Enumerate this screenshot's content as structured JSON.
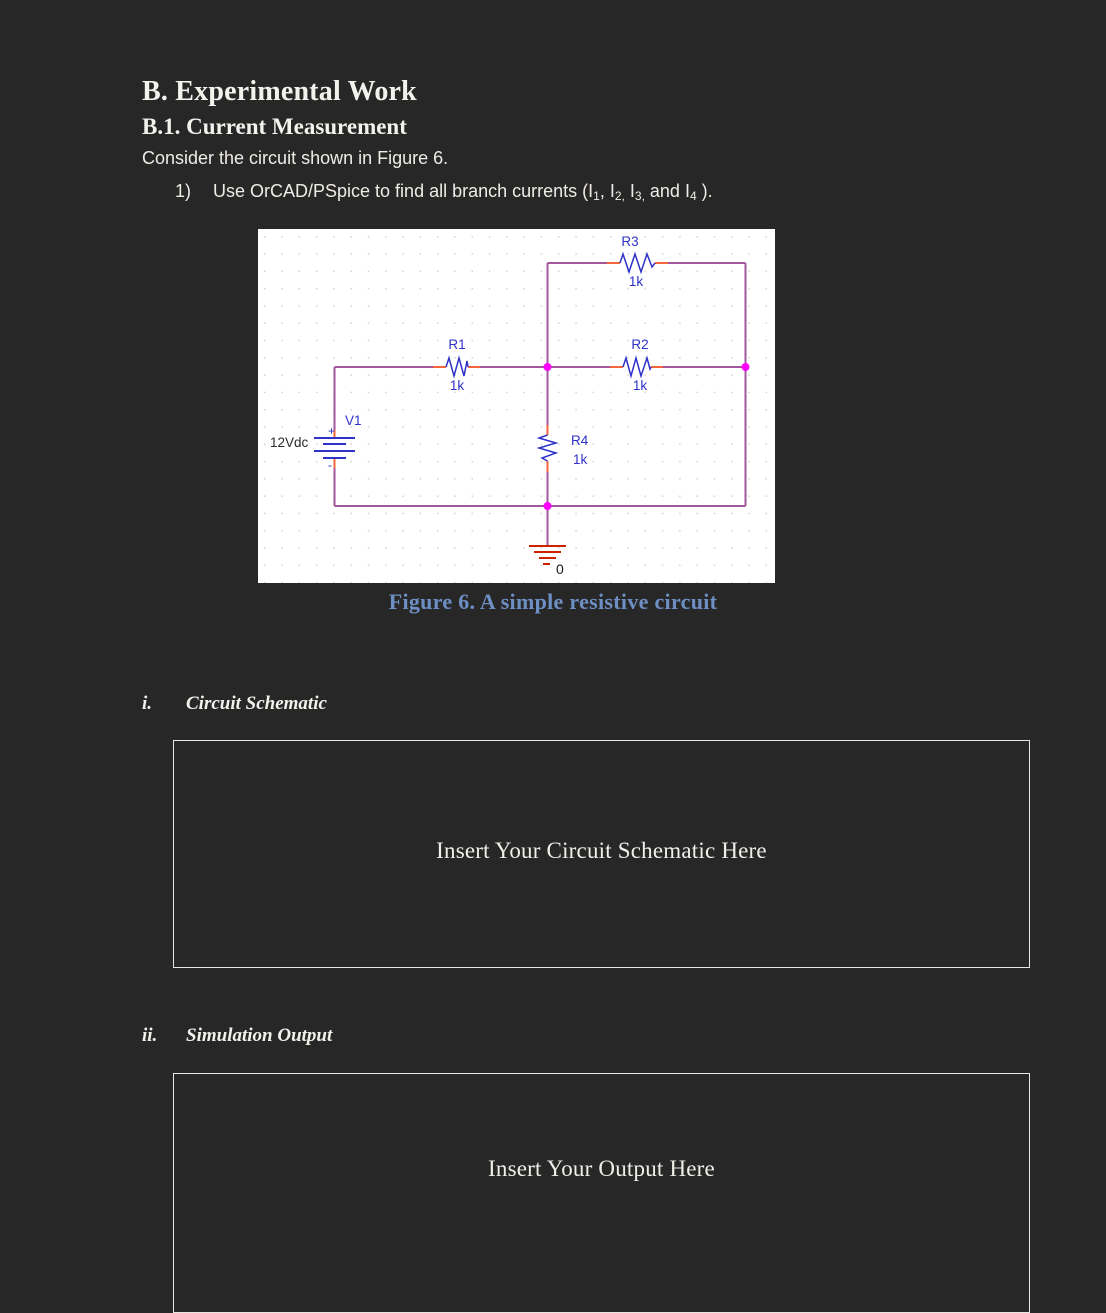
{
  "document": {
    "section_title": "B. Experimental Work",
    "subsection_title": "B.1. Current Measurement",
    "intro_line": "Consider the circuit shown in Figure 6.",
    "task": {
      "number": "1)",
      "text_before": "Use OrCAD/PSpice to find all branch currents (I",
      "sub1": "1",
      "mid1": ", I",
      "sub2": "2,",
      "mid2": " I",
      "sub3": "3,",
      "mid3": " and I",
      "sub4": "4",
      "text_after": " )."
    },
    "figure": {
      "caption": "Figure 6. A simple resistive circuit",
      "caption_color": "#6d8fc4",
      "background": "#ffffff",
      "wire_color": "#a1579c",
      "lead_color": "#f4663b",
      "resistor_color": "#2f31c8",
      "label_color": "#2f31c8",
      "junction_color": "#ff00ff",
      "ground_color": "#cc2200",
      "components": [
        {
          "ref": "R1",
          "value": "1k",
          "type": "resistor",
          "orientation": "horizontal"
        },
        {
          "ref": "R2",
          "value": "1k",
          "type": "resistor",
          "orientation": "horizontal"
        },
        {
          "ref": "R3",
          "value": "1k",
          "type": "resistor",
          "orientation": "horizontal"
        },
        {
          "ref": "R4",
          "value": "1k",
          "type": "resistor",
          "orientation": "vertical"
        },
        {
          "ref": "V1",
          "value": "12Vdc",
          "type": "dc-voltage-source",
          "plus": "+",
          "minus": "-"
        },
        {
          "ref": "0",
          "value": "0",
          "type": "ground"
        }
      ]
    },
    "sections": [
      {
        "numeral": "i.",
        "label": "Circuit Schematic",
        "placeholder": "Insert Your Circuit Schematic Here"
      },
      {
        "numeral": "ii.",
        "label": "Simulation Output",
        "placeholder": "Insert Your Output Here"
      }
    ]
  }
}
